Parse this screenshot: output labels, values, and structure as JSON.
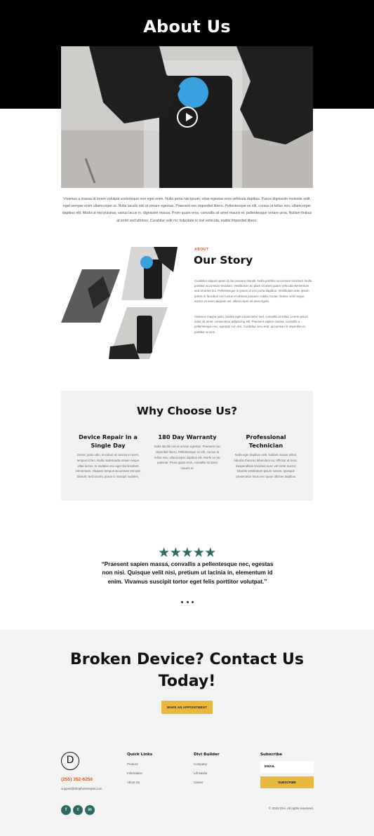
{
  "hero": {
    "title": "About Us",
    "intro": "Vivamus a massa id lorem volutpat scelerisque non eget enim. Nulla porta nisi ipsum, vitae egestas eros vehicula dapibus. Fusce dignissim molestie velit, eget semper enim ullamcorper ut. Nulla iaculis nisi et ornare egestas. Praesent nec imperdiet libero. Pellentesque ex elit, cursus ut tellus non, ullamcorper dapibus elit. Morbi ut nisi pulvinar, varius lacus in, dignissim massa. Proin quam eros, convallis sit amet mauris et, pellentesque ornare urna. Nullam finibus at enim sed ultrices. Curabitur velit mi, vulputate in nisl vehicula, mattis imperdiet libero."
  },
  "story": {
    "label": "ABOUT",
    "title": "Our Story",
    "paragraph1": "Curabitur aliquet quam id dui posuere blandit. Nulla porttitor accumsan tincidunt. Nulla porttitor accumsan tincidunt. Vestibulum ac diam sit amet quam vehicula elementum sed sit amet dui. Pellentesque in ipsum id orci porta dapibus. Vestibulum ante ipsum primis in faucibus orci luctus et ultrices posuere cubilia Curae; Donec velit neque, auctor sit amet aliquam vel, ullamcorper sit amet ligula.",
    "paragraph2": "Vivamus magna justo, lacinia eget consectetur sed, convallis at tellus. Lorem ipsum dolor sit amet, consectetur adipiscing elit. Praesent sapien massa, convallis a pellentesque nec, egestas non nisi. Curabitur arcu erat, accumsan id imperdiet et, porttitor at sem."
  },
  "why": {
    "title": "Why Choose Us?",
    "features": [
      {
        "title": "Device Repair in a Single Day",
        "text": "Donec justo odio, tincidunt ac lacinia et amet, tempus id leo. Nulla malesuada ornare neque vitae luctus. In sodales orci eget dui tincidunt elementum. Aliquam tempus accumsan est quis blandit. Sed iaculis, purus in suscipit sodales."
      },
      {
        "title": "180 Day Warranty",
        "text": "Nulla iaculis nisi et ornare egestas. Praesent nec imperdiet libero. Pellentesque ex elit, cursus ut tellus non, ullamcorper dapibus elit. Morbi ut nisi pulvinar. Proin quam eros, convallis sit amet mauris et."
      },
      {
        "title": "Professional Technician",
        "text": "Nulla eget dapibus velit. Nullam massa tellus, lobortis rhoncus bibendum eu, efficitur at nunc. Suspendisse tincidunt nunc vel tortor auctor, lobortis vestibulum ipsum rutrum. Quisque consectetur risus nec quam ultrices dapibus."
      }
    ]
  },
  "testimonial": {
    "stars": "★★★★★",
    "quote": "“Praesent sapien massa, convallis a pellentesque nec, egestas non nisi. Quisque velit nisi, pretium ut lacinia in, elementum id enim. Vivamus suscipit tortor eget felis porttitor volutpat.”"
  },
  "cta": {
    "title": "Broken Device? Contact Us Today!",
    "button": "MAKE AN APPOINTMENT"
  },
  "footer": {
    "logo_letter": "D",
    "phone": "(255) 352-6258",
    "email": "support@diviphonerepair.com",
    "quick_links_heading": "Quick Links",
    "quick_links": [
      "Product",
      "Information",
      "About Us"
    ],
    "divi_heading": "Divi Builder",
    "divi_links": [
      "Company",
      "Lift Media",
      "Career"
    ],
    "subscribe_heading": "Subscribe",
    "email_placeholder": "EMAIL",
    "subscribe_button": "SUBSCRIBE",
    "social": [
      "f",
      "t",
      "in"
    ],
    "copyright": "© 2022 Divi. All rights reserved."
  },
  "colors": {
    "accent_orange": "#e0571f",
    "accent_yellow": "#e9b93f",
    "accent_teal": "#2c6b63"
  }
}
